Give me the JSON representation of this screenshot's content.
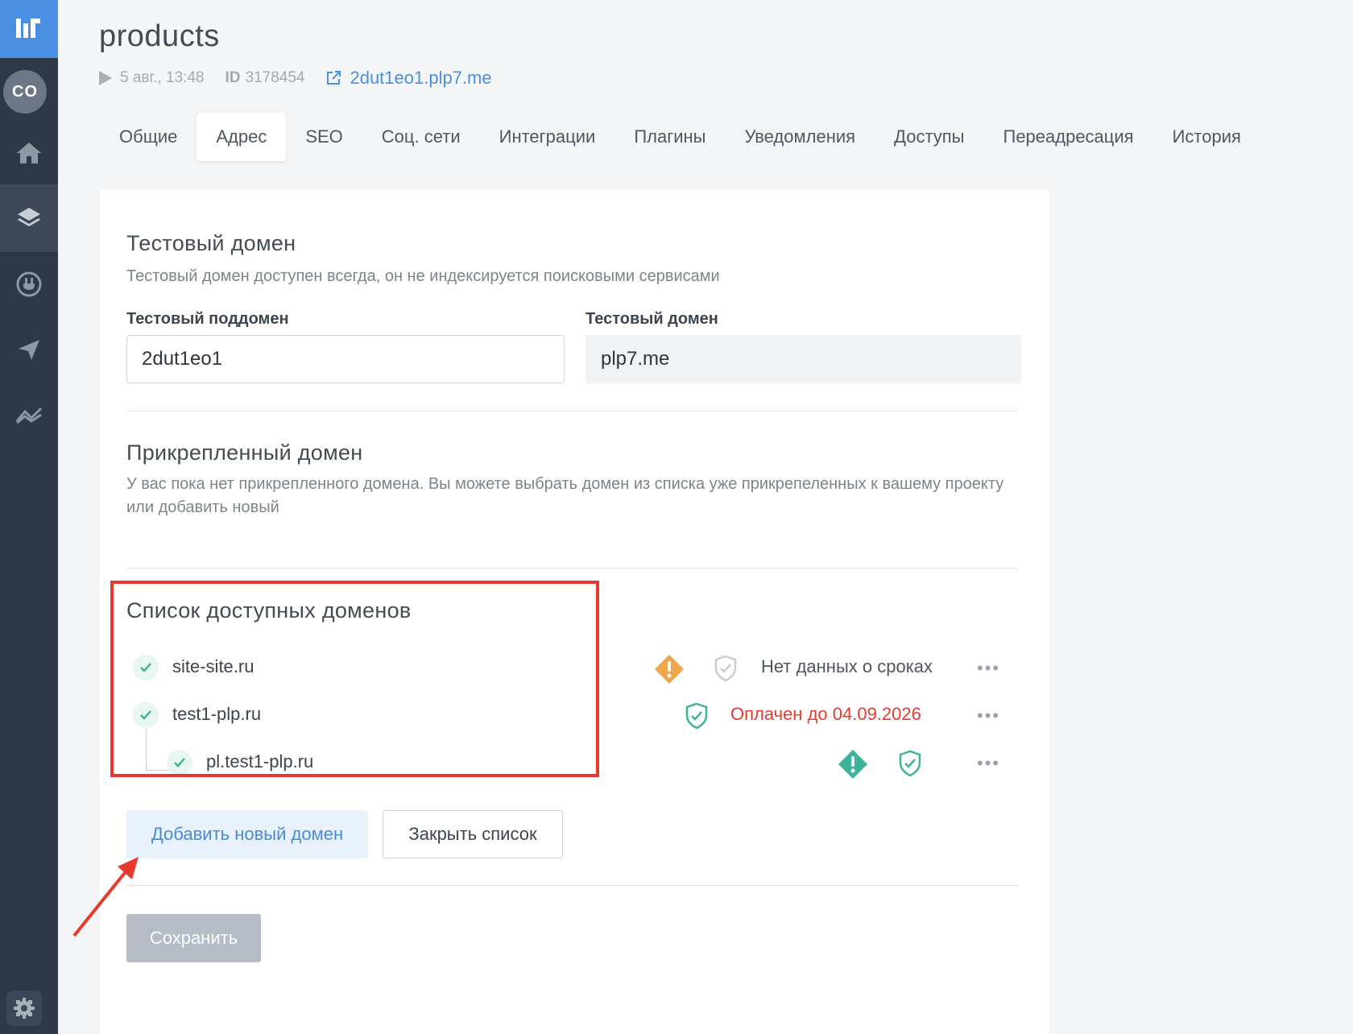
{
  "sidebar": {
    "avatar": "CO",
    "items": [
      "home-icon",
      "layers-icon",
      "plug-icon",
      "send-icon",
      "analytics-icon"
    ],
    "settings": "gear-icon"
  },
  "header": {
    "title": "products",
    "date": "5 авг., 13:48",
    "id_label": "ID",
    "id_value": "3178454",
    "domain_link": "2dut1eo1.plp7.me"
  },
  "tabs": [
    {
      "label": "Общие"
    },
    {
      "label": "Адрес",
      "active": true
    },
    {
      "label": "SEO"
    },
    {
      "label": "Соц. сети"
    },
    {
      "label": "Интеграции"
    },
    {
      "label": "Плагины"
    },
    {
      "label": "Уведомления"
    },
    {
      "label": "Доступы"
    },
    {
      "label": "Переадресация"
    },
    {
      "label": "История"
    }
  ],
  "test_domain": {
    "title": "Тестовый домен",
    "description": "Тестовый домен доступен всегда, он не индексируется поисковыми сервисами",
    "subdomain_label": "Тестовый поддомен",
    "subdomain_value": "2dut1eo1",
    "domain_label": "Тестовый домен",
    "domain_value": "plp7.me"
  },
  "attached_domain": {
    "title": "Прикрепленный домен",
    "description": "У вас пока нет прикрепленного домена. Вы можете выбрать домен из списка уже прикрепеленных к вашему проекту или добавить новый"
  },
  "domain_list": {
    "title": "Список доступных доменов",
    "rows": [
      {
        "name": "site-site.ru",
        "status": "Нет данных о сроках",
        "status_color": "#4f5661",
        "warning": "orange",
        "shield": "gray"
      },
      {
        "name": "test1-plp.ru",
        "status": "Оплачен до 04.09.2026",
        "status_color": "#e8392d",
        "shield": "green"
      },
      {
        "name": "pl.test1-plp.ru",
        "status": "",
        "warning": "green",
        "shield": "green",
        "child": true
      }
    ],
    "more": "•••"
  },
  "buttons": {
    "add_domain": "Добавить новый домен",
    "close_list": "Закрыть список",
    "save": "Сохранить"
  },
  "colors": {
    "accent": "#4a90e2",
    "sidebar": "#2f3846",
    "highlight": "#e8392d",
    "success": "#3fb39a",
    "warning": "#f0a54a"
  }
}
